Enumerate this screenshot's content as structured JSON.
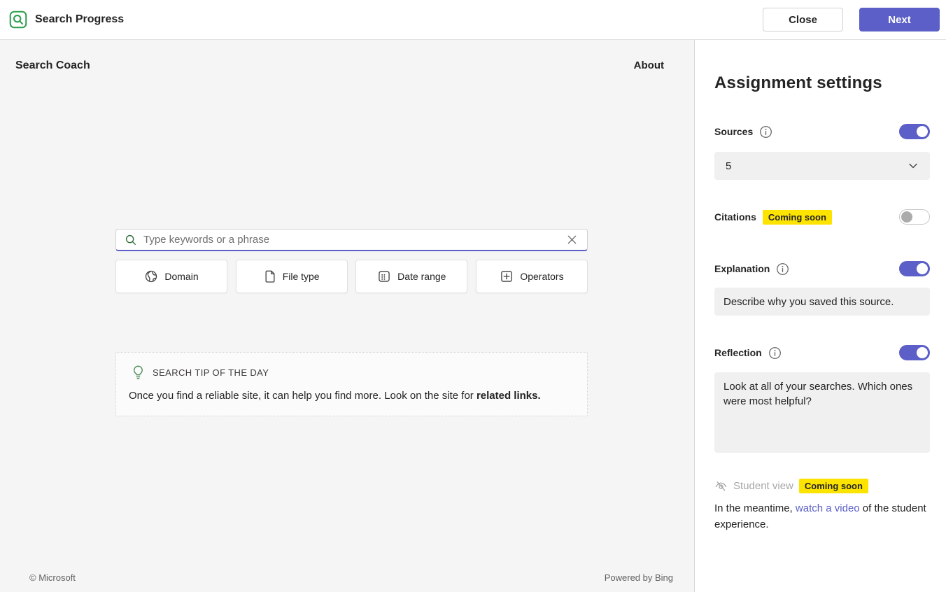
{
  "colors": {
    "accent": "#5b5fc7",
    "brand_green": "#2e9e4e",
    "badge_yellow": "#fde300",
    "muted": "#a6a6a6"
  },
  "header": {
    "app_title": "Search Progress",
    "close_label": "Close",
    "next_label": "Next"
  },
  "main": {
    "title": "Search Coach",
    "about_label": "About",
    "search": {
      "placeholder": "Type keywords or a phrase"
    },
    "filters": [
      {
        "label": "Domain",
        "icon": "globe-icon"
      },
      {
        "label": "File type",
        "icon": "document-icon"
      },
      {
        "label": "Date range",
        "icon": "calendar-icon"
      },
      {
        "label": "Operators",
        "icon": "plus-square-icon"
      }
    ],
    "tip": {
      "title": "SEARCH TIP OF THE DAY",
      "body": "Once you find a reliable site, it can help you find more. Look on the site for ",
      "body_bold": "related links."
    },
    "footer": {
      "copyright": "© Microsoft",
      "powered_by": "Powered by Bing"
    }
  },
  "sidebar": {
    "title": "Assignment settings",
    "sources": {
      "label": "Sources",
      "enabled": true,
      "selected_value": "5"
    },
    "citations": {
      "label": "Citations",
      "badge": "Coming soon",
      "enabled": false
    },
    "explanation": {
      "label": "Explanation",
      "enabled": true,
      "value": "Describe why you saved this source."
    },
    "reflection": {
      "label": "Reflection",
      "enabled": true,
      "value": "Look at all of your searches. Which ones were most helpful?"
    },
    "student_view": {
      "label": "Student view",
      "badge": "Coming soon",
      "meantime_prefix": "In the meantime, ",
      "link_text": "watch a video",
      "meantime_suffix": " of the student experience."
    }
  }
}
